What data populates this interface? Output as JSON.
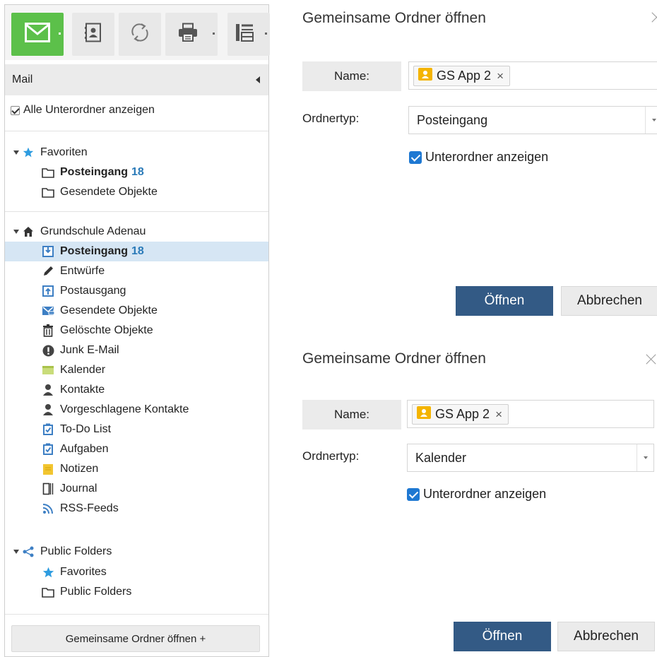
{
  "toolbar": {
    "buttons": [
      {
        "icon": "mail-icon"
      },
      {
        "icon": "address-book-icon"
      },
      {
        "icon": "sync-icon"
      },
      {
        "icon": "print-icon"
      },
      {
        "icon": "view-layout-icon"
      }
    ]
  },
  "nav": {
    "header": "Mail",
    "show_all_subfolders": "Alle Unterordner anzeigen",
    "favorites": {
      "label": "Favoriten",
      "items": [
        {
          "label": "Posteingang",
          "count": "18"
        },
        {
          "label": "Gesendete Objekte"
        }
      ]
    },
    "mailbox": {
      "label": "Grundschule Adenau",
      "items": [
        {
          "label": "Posteingang",
          "count": "18",
          "icon": "inbox-icon"
        },
        {
          "label": "Entwürfe",
          "icon": "pencil-icon"
        },
        {
          "label": "Postausgang",
          "icon": "outbox-icon"
        },
        {
          "label": "Gesendete Objekte",
          "icon": "sent-icon"
        },
        {
          "label": "Gelöschte Objekte",
          "icon": "trash-icon"
        },
        {
          "label": "Junk E-Mail",
          "icon": "junk-icon"
        },
        {
          "label": "Kalender",
          "icon": "calendar-icon"
        },
        {
          "label": "Kontakte",
          "icon": "contact-icon"
        },
        {
          "label": "Vorgeschlagene Kontakte",
          "icon": "contact-icon"
        },
        {
          "label": "To-Do List",
          "icon": "task-icon"
        },
        {
          "label": "Aufgaben",
          "icon": "task-icon"
        },
        {
          "label": "Notizen",
          "icon": "note-icon"
        },
        {
          "label": "Journal",
          "icon": "journal-icon"
        },
        {
          "label": "RSS-Feeds",
          "icon": "rss-icon"
        }
      ]
    },
    "public": {
      "label": "Public Folders",
      "items": [
        {
          "label": "Favorites",
          "icon": "star-icon"
        },
        {
          "label": "Public Folders",
          "icon": "folder-icon"
        }
      ]
    },
    "open_shared_button": "Gemeinsame Ordner öffnen +"
  },
  "dialogs": [
    {
      "title": "Gemeinsame Ordner öffnen",
      "name_label": "Name:",
      "chip": "GS App 2",
      "chip_remove": "×",
      "type_label": "Ordnertyp:",
      "type_value": "Posteingang",
      "subfolders_label": "Unterordner anzeigen",
      "open_button": "Öffnen",
      "cancel_button": "Abbrechen"
    },
    {
      "title": "Gemeinsame Ordner öffnen",
      "name_label": "Name:",
      "chip": "GS App 2",
      "chip_remove": "×",
      "type_label": "Ordnertyp:",
      "type_value": "Kalender",
      "subfolders_label": "Unterordner anzeigen",
      "open_button": "Öffnen",
      "cancel_button": "Abbrechen"
    }
  ],
  "colors": {
    "mail_green": "#5cc04a",
    "selected_row": "#d6e6f4",
    "count_blue": "#2a7ab8",
    "primary_button": "#335a85",
    "checkbox_blue": "#1e78d2",
    "chip_icon": "#f4b400"
  }
}
